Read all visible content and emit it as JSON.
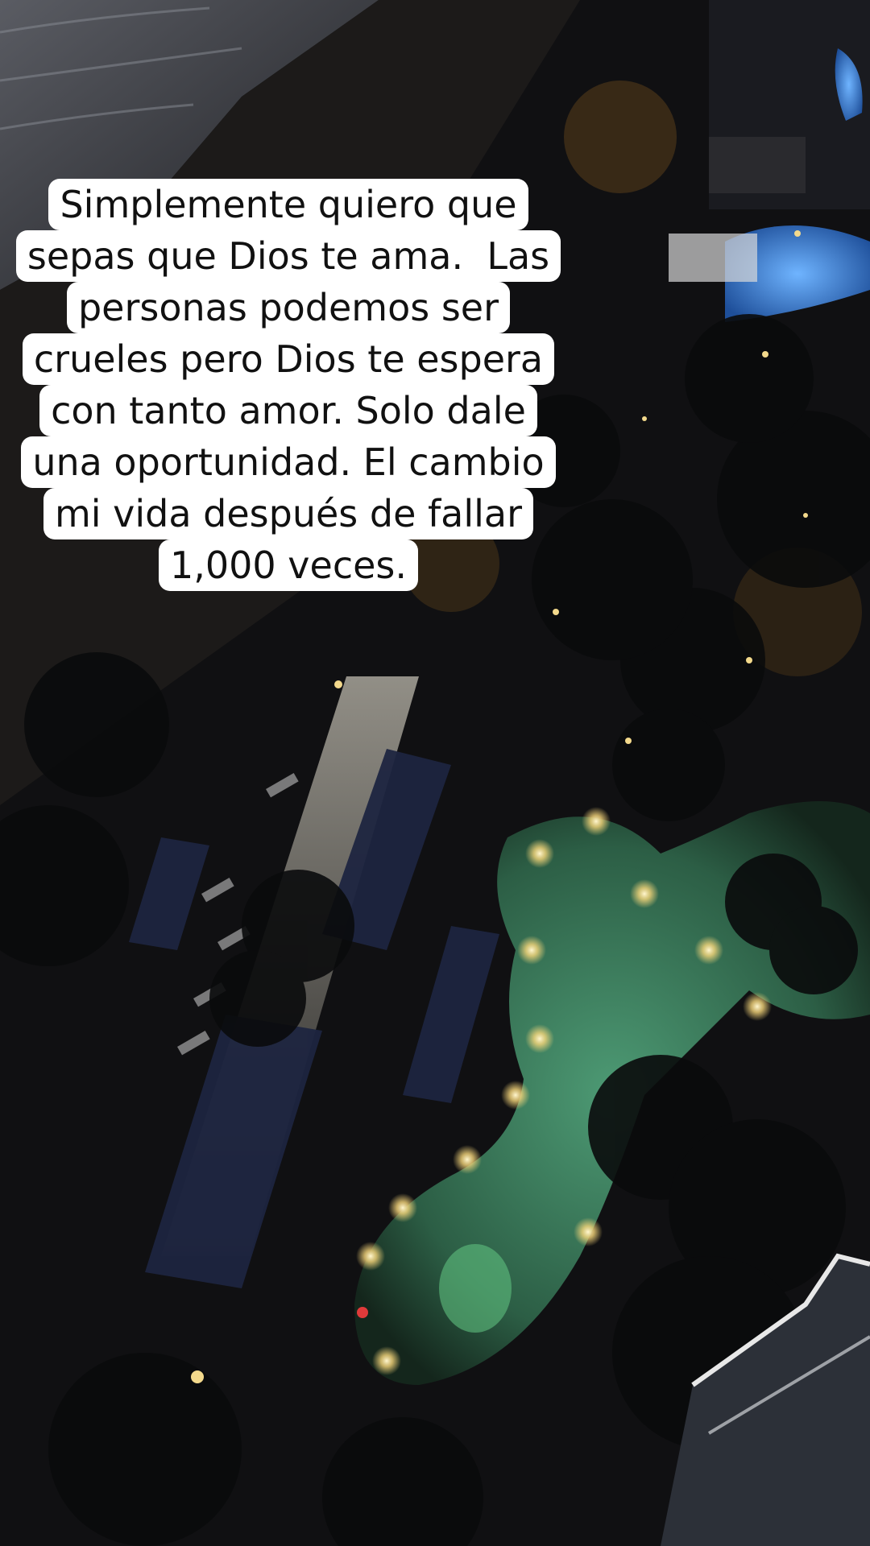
{
  "caption": {
    "lines": [
      "Simplemente quiero que",
      "sepas que Dios te ama.  Las",
      "personas podemos ser",
      "crueles pero Dios te espera",
      "con tanto amor. Solo dale",
      "una oportunidad. El cambio",
      "mi vida después de fallar",
      "1,000 veces."
    ]
  },
  "scene": {
    "description_icon": "night-resort-pool-photo-icon",
    "colors": {
      "pool_green": "#2f6b4f",
      "pool_blue": "#3b7fd1",
      "warm_light": "#f0b24a",
      "ocean": "#3b3f48",
      "sand": "#1e1c1c"
    }
  }
}
